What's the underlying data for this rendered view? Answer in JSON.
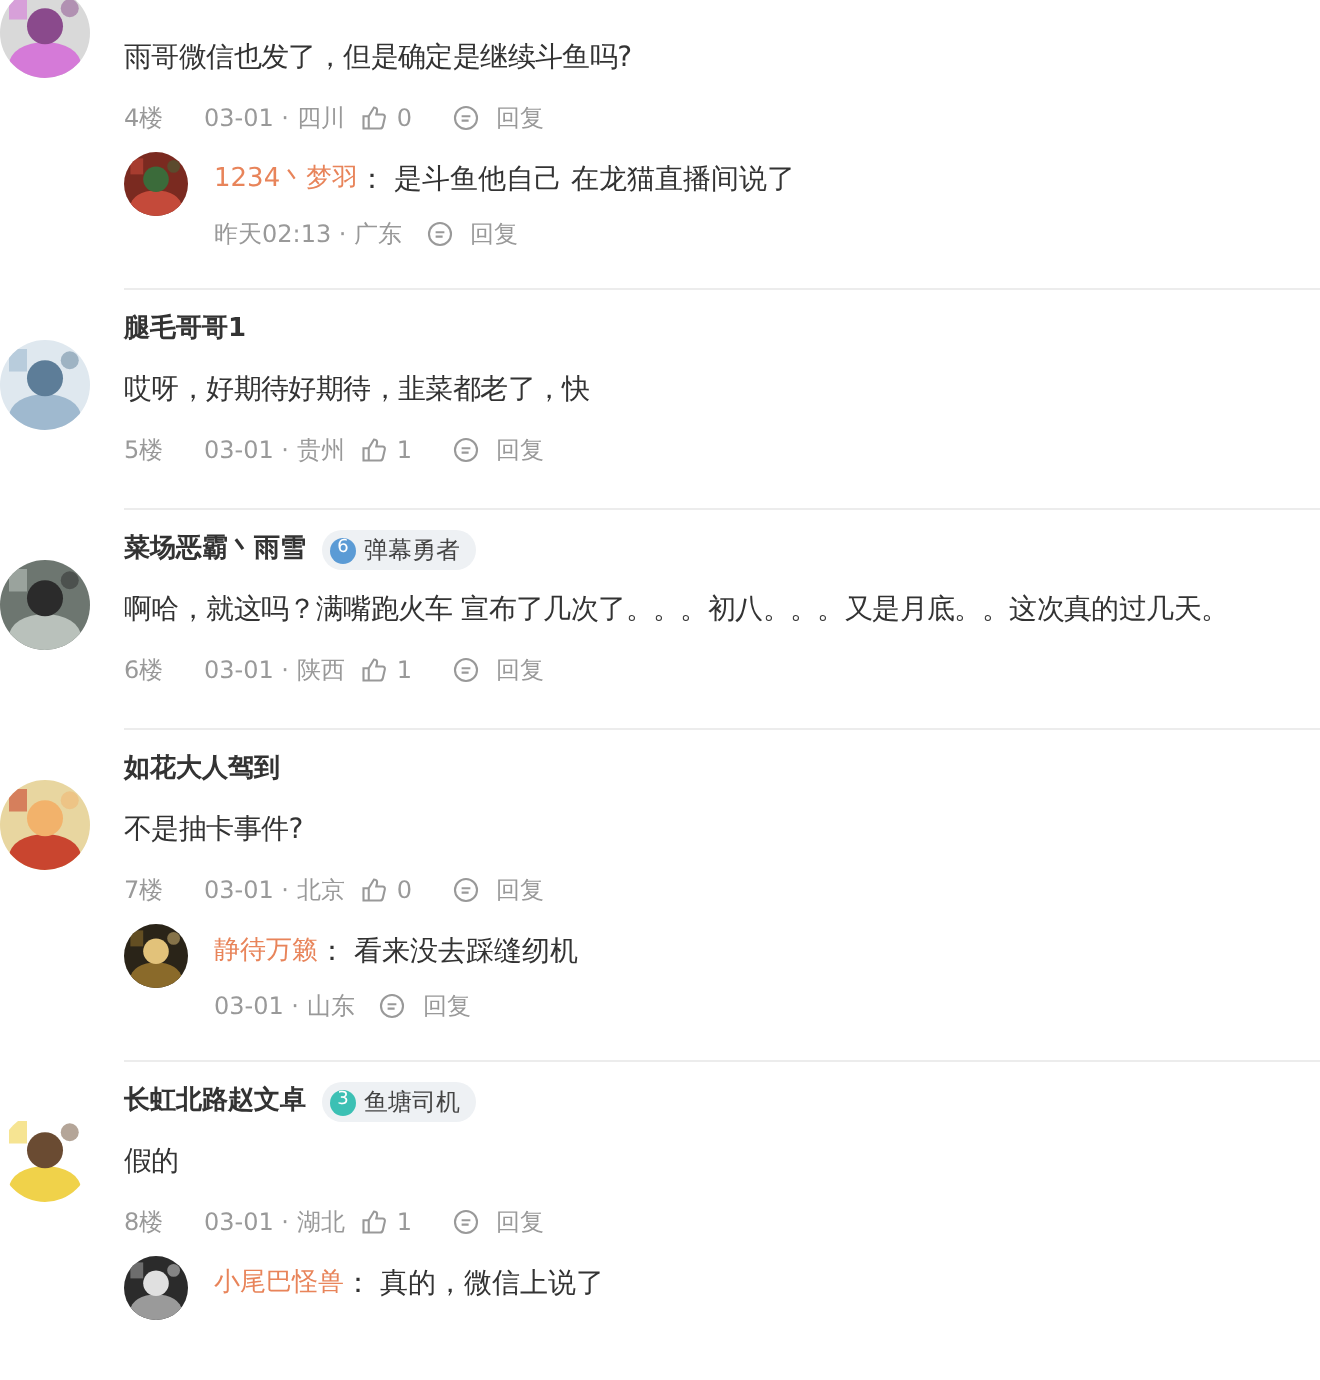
{
  "comments": [
    {
      "text": "雨哥微信也发了，但是确定是继续斗鱼吗?",
      "floor": "4楼",
      "meta": "03-01 · 四川",
      "likes": "0",
      "reply_label": "回复",
      "replies": [
        {
          "name": "1234丶梦羽",
          "separator": "：",
          "text": "是斗鱼他自己 在龙猫直播间说了",
          "meta": "昨天02:13 · 广东",
          "reply_label": "回复"
        }
      ]
    },
    {
      "name": "腿毛哥哥1",
      "text": "哎呀，好期待好期待，韭菜都老了，快",
      "floor": "5楼",
      "meta": "03-01 · 贵州",
      "likes": "1",
      "reply_label": "回复"
    },
    {
      "name": "菜场恶霸丶雨雪",
      "badge": {
        "level": "6",
        "label": "弹幕勇者",
        "color": "#5b9bd5"
      },
      "text": "啊哈，就这吗？满嘴跑火车 宣布了几次了。。。初八。。。又是月底。。这次真的过几天。",
      "floor": "6楼",
      "meta": "03-01 · 陕西",
      "likes": "1",
      "reply_label": "回复"
    },
    {
      "name": "如花大人驾到",
      "text": "不是抽卡事件?",
      "floor": "7楼",
      "meta": "03-01 · 北京",
      "likes": "0",
      "reply_label": "回复",
      "replies": [
        {
          "name": "静待万籁",
          "separator": "：",
          "text": "看来没去踩缝纫机",
          "meta": "03-01 · 山东",
          "reply_label": "回复"
        }
      ]
    },
    {
      "name": "长虹北路赵文卓",
      "badge": {
        "level": "3",
        "label": "鱼塘司机",
        "color": "#3cc0b4"
      },
      "text": "假的",
      "floor": "8楼",
      "meta": "03-01 · 湖北",
      "likes": "1",
      "reply_label": "回复",
      "replies": [
        {
          "name": "小尾巴怪兽",
          "separator": "：",
          "text": "真的，微信上说了"
        }
      ]
    }
  ]
}
